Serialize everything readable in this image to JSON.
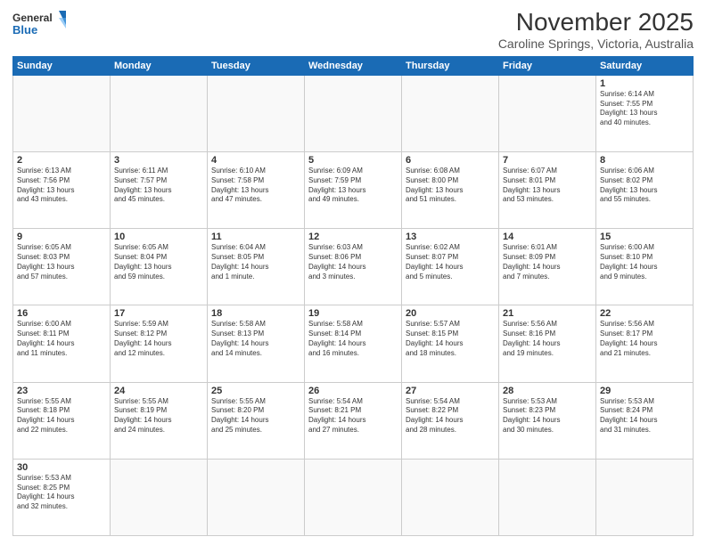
{
  "header": {
    "logo_line1": "General",
    "logo_line2": "Blue",
    "title": "November 2025",
    "subtitle": "Caroline Springs, Victoria, Australia"
  },
  "days_of_week": [
    "Sunday",
    "Monday",
    "Tuesday",
    "Wednesday",
    "Thursday",
    "Friday",
    "Saturday"
  ],
  "weeks": [
    [
      {
        "day": "",
        "info": ""
      },
      {
        "day": "",
        "info": ""
      },
      {
        "day": "",
        "info": ""
      },
      {
        "day": "",
        "info": ""
      },
      {
        "day": "",
        "info": ""
      },
      {
        "day": "",
        "info": ""
      },
      {
        "day": "1",
        "info": "Sunrise: 6:14 AM\nSunset: 7:55 PM\nDaylight: 13 hours\nand 40 minutes."
      }
    ],
    [
      {
        "day": "2",
        "info": "Sunrise: 6:13 AM\nSunset: 7:56 PM\nDaylight: 13 hours\nand 43 minutes."
      },
      {
        "day": "3",
        "info": "Sunrise: 6:11 AM\nSunset: 7:57 PM\nDaylight: 13 hours\nand 45 minutes."
      },
      {
        "day": "4",
        "info": "Sunrise: 6:10 AM\nSunset: 7:58 PM\nDaylight: 13 hours\nand 47 minutes."
      },
      {
        "day": "5",
        "info": "Sunrise: 6:09 AM\nSunset: 7:59 PM\nDaylight: 13 hours\nand 49 minutes."
      },
      {
        "day": "6",
        "info": "Sunrise: 6:08 AM\nSunset: 8:00 PM\nDaylight: 13 hours\nand 51 minutes."
      },
      {
        "day": "7",
        "info": "Sunrise: 6:07 AM\nSunset: 8:01 PM\nDaylight: 13 hours\nand 53 minutes."
      },
      {
        "day": "8",
        "info": "Sunrise: 6:06 AM\nSunset: 8:02 PM\nDaylight: 13 hours\nand 55 minutes."
      }
    ],
    [
      {
        "day": "9",
        "info": "Sunrise: 6:05 AM\nSunset: 8:03 PM\nDaylight: 13 hours\nand 57 minutes."
      },
      {
        "day": "10",
        "info": "Sunrise: 6:05 AM\nSunset: 8:04 PM\nDaylight: 13 hours\nand 59 minutes."
      },
      {
        "day": "11",
        "info": "Sunrise: 6:04 AM\nSunset: 8:05 PM\nDaylight: 14 hours\nand 1 minute."
      },
      {
        "day": "12",
        "info": "Sunrise: 6:03 AM\nSunset: 8:06 PM\nDaylight: 14 hours\nand 3 minutes."
      },
      {
        "day": "13",
        "info": "Sunrise: 6:02 AM\nSunset: 8:07 PM\nDaylight: 14 hours\nand 5 minutes."
      },
      {
        "day": "14",
        "info": "Sunrise: 6:01 AM\nSunset: 8:09 PM\nDaylight: 14 hours\nand 7 minutes."
      },
      {
        "day": "15",
        "info": "Sunrise: 6:00 AM\nSunset: 8:10 PM\nDaylight: 14 hours\nand 9 minutes."
      }
    ],
    [
      {
        "day": "16",
        "info": "Sunrise: 6:00 AM\nSunset: 8:11 PM\nDaylight: 14 hours\nand 11 minutes."
      },
      {
        "day": "17",
        "info": "Sunrise: 5:59 AM\nSunset: 8:12 PM\nDaylight: 14 hours\nand 12 minutes."
      },
      {
        "day": "18",
        "info": "Sunrise: 5:58 AM\nSunset: 8:13 PM\nDaylight: 14 hours\nand 14 minutes."
      },
      {
        "day": "19",
        "info": "Sunrise: 5:58 AM\nSunset: 8:14 PM\nDaylight: 14 hours\nand 16 minutes."
      },
      {
        "day": "20",
        "info": "Sunrise: 5:57 AM\nSunset: 8:15 PM\nDaylight: 14 hours\nand 18 minutes."
      },
      {
        "day": "21",
        "info": "Sunrise: 5:56 AM\nSunset: 8:16 PM\nDaylight: 14 hours\nand 19 minutes."
      },
      {
        "day": "22",
        "info": "Sunrise: 5:56 AM\nSunset: 8:17 PM\nDaylight: 14 hours\nand 21 minutes."
      }
    ],
    [
      {
        "day": "23",
        "info": "Sunrise: 5:55 AM\nSunset: 8:18 PM\nDaylight: 14 hours\nand 22 minutes."
      },
      {
        "day": "24",
        "info": "Sunrise: 5:55 AM\nSunset: 8:19 PM\nDaylight: 14 hours\nand 24 minutes."
      },
      {
        "day": "25",
        "info": "Sunrise: 5:55 AM\nSunset: 8:20 PM\nDaylight: 14 hours\nand 25 minutes."
      },
      {
        "day": "26",
        "info": "Sunrise: 5:54 AM\nSunset: 8:21 PM\nDaylight: 14 hours\nand 27 minutes."
      },
      {
        "day": "27",
        "info": "Sunrise: 5:54 AM\nSunset: 8:22 PM\nDaylight: 14 hours\nand 28 minutes."
      },
      {
        "day": "28",
        "info": "Sunrise: 5:53 AM\nSunset: 8:23 PM\nDaylight: 14 hours\nand 30 minutes."
      },
      {
        "day": "29",
        "info": "Sunrise: 5:53 AM\nSunset: 8:24 PM\nDaylight: 14 hours\nand 31 minutes."
      }
    ],
    [
      {
        "day": "30",
        "info": "Sunrise: 5:53 AM\nSunset: 8:25 PM\nDaylight: 14 hours\nand 32 minutes."
      },
      {
        "day": "",
        "info": ""
      },
      {
        "day": "",
        "info": ""
      },
      {
        "day": "",
        "info": ""
      },
      {
        "day": "",
        "info": ""
      },
      {
        "day": "",
        "info": ""
      },
      {
        "day": "",
        "info": ""
      }
    ]
  ]
}
